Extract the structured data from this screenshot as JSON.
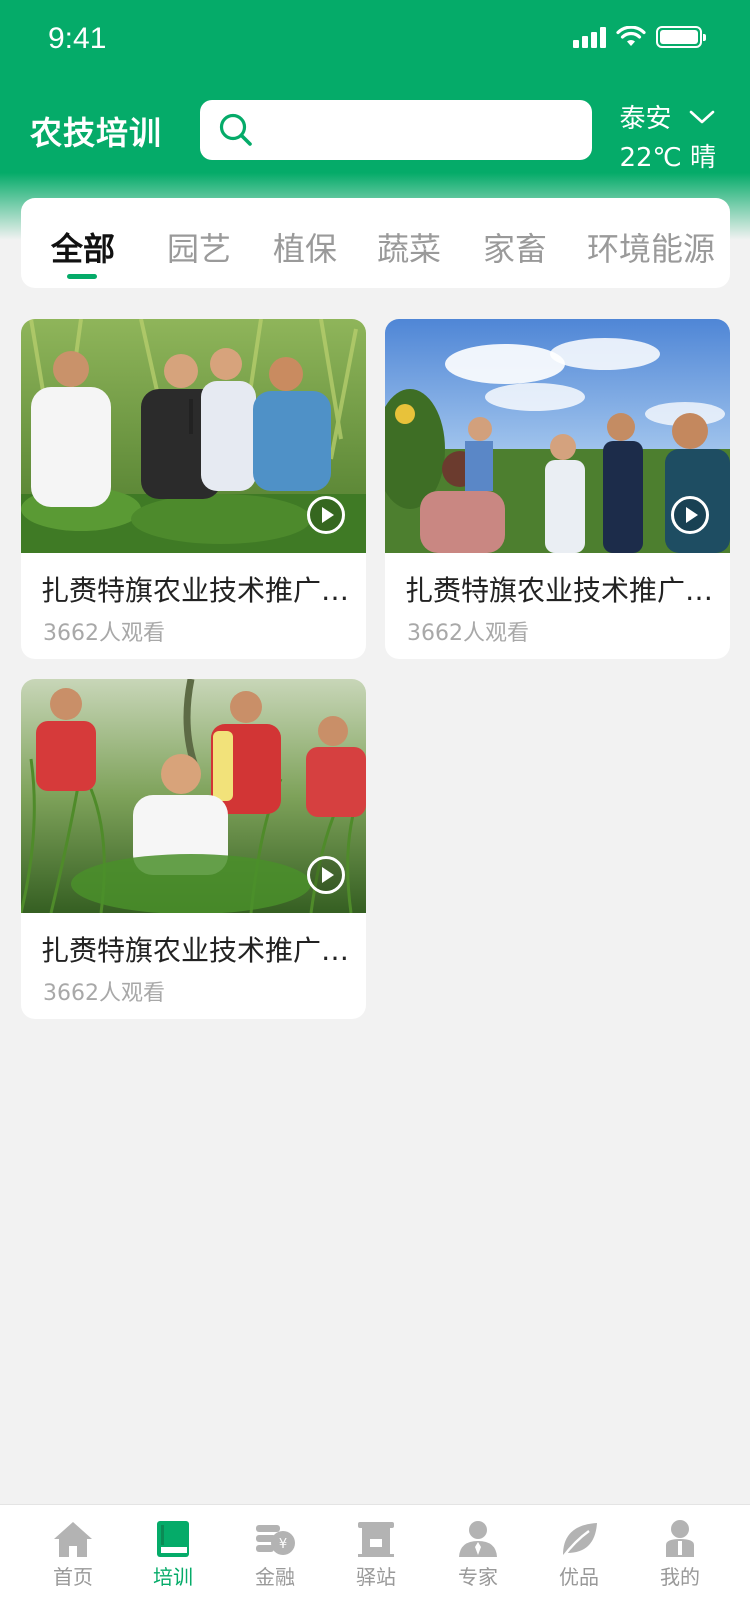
{
  "status": {
    "time": "9:41"
  },
  "header": {
    "title": "农技培训",
    "search_placeholder": "",
    "weather": {
      "city": "泰安",
      "temp": "22℃ 晴"
    }
  },
  "category_tabs": [
    {
      "label": "全部",
      "active": true
    },
    {
      "label": "园艺",
      "active": false
    },
    {
      "label": "植保",
      "active": false
    },
    {
      "label": "蔬菜",
      "active": false
    },
    {
      "label": "家畜",
      "active": false
    },
    {
      "label": "环境能源",
      "active": false
    }
  ],
  "videos": [
    {
      "title": "扎赉特旗农业技术推广培训",
      "views": "3662人观看",
      "image": "corn-field-group-photo"
    },
    {
      "title": "扎赉特旗农业技术推广培训",
      "views": "3662人观看",
      "image": "sunflower-field-group-photo"
    },
    {
      "title": "扎赉特旗农业技术推广培训",
      "views": "3662人观看",
      "image": "crop-field-inspection-photo"
    }
  ],
  "bottom_nav": [
    {
      "label": "首页",
      "icon": "home-icon",
      "active": false
    },
    {
      "label": "培训",
      "icon": "book-icon",
      "active": true
    },
    {
      "label": "金融",
      "icon": "finance-icon",
      "active": false
    },
    {
      "label": "驿站",
      "icon": "station-icon",
      "active": false
    },
    {
      "label": "专家",
      "icon": "expert-icon",
      "active": false
    },
    {
      "label": "优品",
      "icon": "leaf-icon",
      "active": false
    },
    {
      "label": "我的",
      "icon": "profile-icon",
      "active": false
    }
  ],
  "colors": {
    "brand": "#05ab69",
    "background": "#f2f2f2",
    "inactive": "#999999"
  }
}
